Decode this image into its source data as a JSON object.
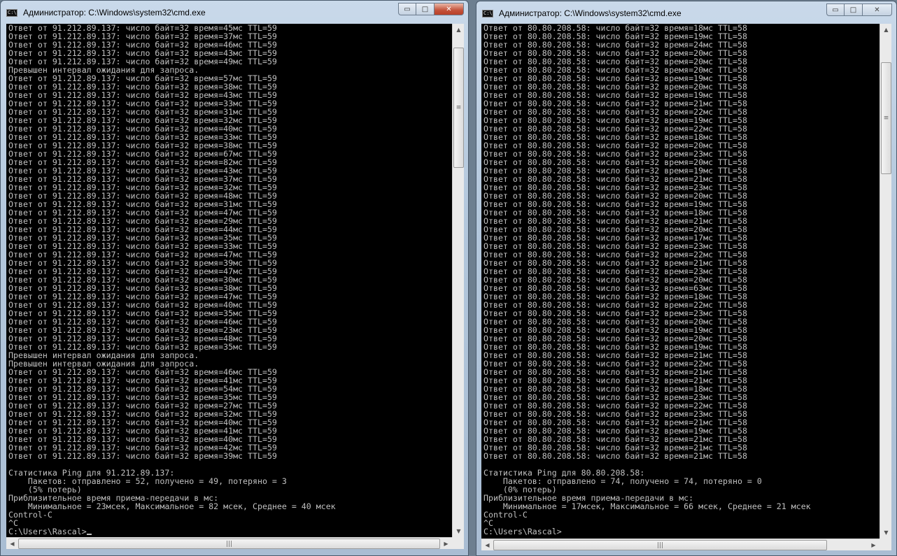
{
  "windows": [
    {
      "title": "Администратор: C:\\Windows\\system32\\cmd.exe",
      "icon": "cmd-icon",
      "controls": {
        "minimize": "▭",
        "maximize": "□",
        "close": "✕"
      },
      "lines": [
        "Ответ от 91.212.89.137: число байт=32 время=45мс TTL=59",
        "Ответ от 91.212.89.137: число байт=32 время=37мс TTL=59",
        "Ответ от 91.212.89.137: число байт=32 время=46мс TTL=59",
        "Ответ от 91.212.89.137: число байт=32 время=43мс TTL=59",
        "Ответ от 91.212.89.137: число байт=32 время=49мс TTL=59",
        "Превышен интервал ожидания для запроса.",
        "Ответ от 91.212.89.137: число байт=32 время=57мс TTL=59",
        "Ответ от 91.212.89.137: число байт=32 время=38мс TTL=59",
        "Ответ от 91.212.89.137: число байт=32 время=43мс TTL=59",
        "Ответ от 91.212.89.137: число байт=32 время=33мс TTL=59",
        "Ответ от 91.212.89.137: число байт=32 время=31мс TTL=59",
        "Ответ от 91.212.89.137: число байт=32 время=32мс TTL=59",
        "Ответ от 91.212.89.137: число байт=32 время=40мс TTL=59",
        "Ответ от 91.212.89.137: число байт=32 время=33мс TTL=59",
        "Ответ от 91.212.89.137: число байт=32 время=38мс TTL=59",
        "Ответ от 91.212.89.137: число байт=32 время=67мс TTL=59",
        "Ответ от 91.212.89.137: число байт=32 время=82мс TTL=59",
        "Ответ от 91.212.89.137: число байт=32 время=43мс TTL=59",
        "Ответ от 91.212.89.137: число байт=32 время=37мс TTL=59",
        "Ответ от 91.212.89.137: число байт=32 время=32мс TTL=59",
        "Ответ от 91.212.89.137: число байт=32 время=48мс TTL=59",
        "Ответ от 91.212.89.137: число байт=32 время=31мс TTL=59",
        "Ответ от 91.212.89.137: число байт=32 время=47мс TTL=59",
        "Ответ от 91.212.89.137: число байт=32 время=29мс TTL=59",
        "Ответ от 91.212.89.137: число байт=32 время=44мс TTL=59",
        "Ответ от 91.212.89.137: число байт=32 время=35мс TTL=59",
        "Ответ от 91.212.89.137: число байт=32 время=33мс TTL=59",
        "Ответ от 91.212.89.137: число байт=32 время=47мс TTL=59",
        "Ответ от 91.212.89.137: число байт=32 время=39мс TTL=59",
        "Ответ от 91.212.89.137: число байт=32 время=47мс TTL=59",
        "Ответ от 91.212.89.137: число байт=32 время=30мс TTL=59",
        "Ответ от 91.212.89.137: число байт=32 время=38мс TTL=59",
        "Ответ от 91.212.89.137: число байт=32 время=47мс TTL=59",
        "Ответ от 91.212.89.137: число байт=32 время=40мс TTL=59",
        "Ответ от 91.212.89.137: число байт=32 время=35мс TTL=59",
        "Ответ от 91.212.89.137: число байт=32 время=46мс TTL=59",
        "Ответ от 91.212.89.137: число байт=32 время=23мс TTL=59",
        "Ответ от 91.212.89.137: число байт=32 время=48мс TTL=59",
        "Ответ от 91.212.89.137: число байт=32 время=35мс TTL=59",
        "Превышен интервал ожидания для запроса.",
        "Превышен интервал ожидания для запроса.",
        "Ответ от 91.212.89.137: число байт=32 время=46мс TTL=59",
        "Ответ от 91.212.89.137: число байт=32 время=41мс TTL=59",
        "Ответ от 91.212.89.137: число байт=32 время=54мс TTL=59",
        "Ответ от 91.212.89.137: число байт=32 время=35мс TTL=59",
        "Ответ от 91.212.89.137: число байт=32 время=27мс TTL=59",
        "Ответ от 91.212.89.137: число байт=32 время=32мс TTL=59",
        "Ответ от 91.212.89.137: число байт=32 время=40мс TTL=59",
        "Ответ от 91.212.89.137: число байт=32 время=41мс TTL=59",
        "Ответ от 91.212.89.137: число байт=32 время=40мс TTL=59",
        "Ответ от 91.212.89.137: число байт=32 время=42мс TTL=59",
        "Ответ от 91.212.89.137: число байт=32 время=39мс TTL=59",
        "",
        "Статистика Ping для 91.212.89.137:",
        "    Пакетов: отправлено = 52, получено = 49, потеряно = 3",
        "    (5% потерь)",
        "Приблизительное время приема-передачи в мс:",
        "    Минимальное = 23мсек, Максимальное = 82 мсек, Среднее = 40 мсек",
        "Control-C",
        "^C",
        "C:\\Users\\Rascal>"
      ]
    },
    {
      "title": "Администратор: C:\\Windows\\system32\\cmd.exe",
      "icon": "cmd-icon",
      "controls": {
        "minimize": "▭",
        "maximize": "□",
        "close": "✕"
      },
      "lines": [
        "Ответ от 80.80.208.58: число байт=32 время=18мс TTL=58",
        "Ответ от 80.80.208.58: число байт=32 время=19мс TTL=58",
        "Ответ от 80.80.208.58: число байт=32 время=24мс TTL=58",
        "Ответ от 80.80.208.58: число байт=32 время=20мс TTL=58",
        "Ответ от 80.80.208.58: число байт=32 время=20мс TTL=58",
        "Ответ от 80.80.208.58: число байт=32 время=20мс TTL=58",
        "Ответ от 80.80.208.58: число байт=32 время=19мс TTL=58",
        "Ответ от 80.80.208.58: число байт=32 время=20мс TTL=58",
        "Ответ от 80.80.208.58: число байт=32 время=19мс TTL=58",
        "Ответ от 80.80.208.58: число байт=32 время=21мс TTL=58",
        "Ответ от 80.80.208.58: число байт=32 время=22мс TTL=58",
        "Ответ от 80.80.208.58: число байт=32 время=19мс TTL=58",
        "Ответ от 80.80.208.58: число байт=32 время=22мс TTL=58",
        "Ответ от 80.80.208.58: число байт=32 время=18мс TTL=58",
        "Ответ от 80.80.208.58: число байт=32 время=20мс TTL=58",
        "Ответ от 80.80.208.58: число байт=32 время=23мс TTL=58",
        "Ответ от 80.80.208.58: число байт=32 время=20мс TTL=58",
        "Ответ от 80.80.208.58: число байт=32 время=19мс TTL=58",
        "Ответ от 80.80.208.58: число байт=32 время=21мс TTL=58",
        "Ответ от 80.80.208.58: число байт=32 время=23мс TTL=58",
        "Ответ от 80.80.208.58: число байт=32 время=20мс TTL=58",
        "Ответ от 80.80.208.58: число байт=32 время=19мс TTL=58",
        "Ответ от 80.80.208.58: число байт=32 время=18мс TTL=58",
        "Ответ от 80.80.208.58: число байт=32 время=21мс TTL=58",
        "Ответ от 80.80.208.58: число байт=32 время=20мс TTL=58",
        "Ответ от 80.80.208.58: число байт=32 время=17мс TTL=58",
        "Ответ от 80.80.208.58: число байт=32 время=23мс TTL=58",
        "Ответ от 80.80.208.58: число байт=32 время=22мс TTL=58",
        "Ответ от 80.80.208.58: число байт=32 время=21мс TTL=58",
        "Ответ от 80.80.208.58: число байт=32 время=23мс TTL=58",
        "Ответ от 80.80.208.58: число байт=32 время=20мс TTL=58",
        "Ответ от 80.80.208.58: число байт=32 время=63мс TTL=58",
        "Ответ от 80.80.208.58: число байт=32 время=18мс TTL=58",
        "Ответ от 80.80.208.58: число байт=32 время=22мс TTL=58",
        "Ответ от 80.80.208.58: число байт=32 время=23мс TTL=58",
        "Ответ от 80.80.208.58: число байт=32 время=20мс TTL=58",
        "Ответ от 80.80.208.58: число байт=32 время=19мс TTL=58",
        "Ответ от 80.80.208.58: число байт=32 время=20мс TTL=58",
        "Ответ от 80.80.208.58: число байт=32 время=19мс TTL=58",
        "Ответ от 80.80.208.58: число байт=32 время=21мс TTL=58",
        "Ответ от 80.80.208.58: число байт=32 время=22мс TTL=58",
        "Ответ от 80.80.208.58: число байт=32 время=21мс TTL=58",
        "Ответ от 80.80.208.58: число байт=32 время=21мс TTL=58",
        "Ответ от 80.80.208.58: число байт=32 время=18мс TTL=58",
        "Ответ от 80.80.208.58: число байт=32 время=23мс TTL=58",
        "Ответ от 80.80.208.58: число байт=32 время=22мс TTL=58",
        "Ответ от 80.80.208.58: число байт=32 время=23мс TTL=58",
        "Ответ от 80.80.208.58: число байт=32 время=21мс TTL=58",
        "Ответ от 80.80.208.58: число байт=32 время=19мс TTL=58",
        "Ответ от 80.80.208.58: число байт=32 время=21мс TTL=58",
        "Ответ от 80.80.208.58: число байт=32 время=21мс TTL=58",
        "Ответ от 80.80.208.58: число байт=32 время=21мс TTL=58",
        "",
        "Статистика Ping для 80.80.208.58:",
        "    Пакетов: отправлено = 74, получено = 74, потеряно = 0",
        "    (0% потерь)",
        "Приблизительное время приема-передачи в мс:",
        "    Минимальное = 17мсек, Максимальное = 66 мсек, Среднее = 21 мсек",
        "Control-C",
        "^C",
        "C:\\Users\\Rascal>"
      ]
    }
  ],
  "scrollbar": {
    "up": "▲",
    "down": "▼",
    "left": "◀",
    "right": "▶",
    "grip": "≡",
    "hgrip": "|||"
  }
}
